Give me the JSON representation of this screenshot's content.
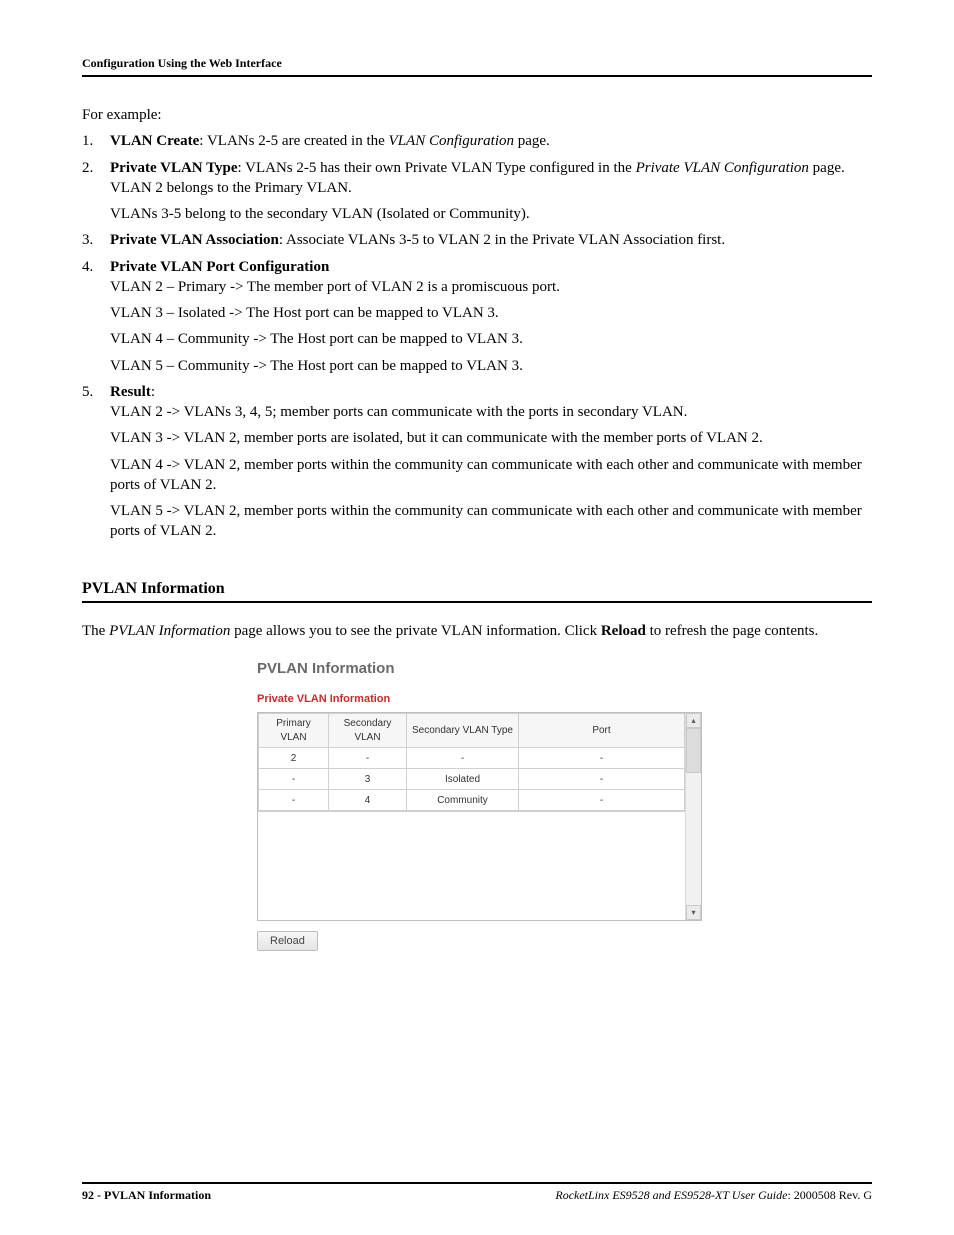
{
  "header": {
    "running": "Configuration Using the Web Interface"
  },
  "intro": "For example:",
  "steps": [
    {
      "label_bold": "VLAN Create",
      "label_rest": ": VLANs 2-5 are created in the ",
      "label_ital": "VLAN Configuration",
      "label_tail": " page.",
      "subs": []
    },
    {
      "label_bold": "Private VLAN Type",
      "label_rest": ": VLANs 2-5 has their own Private VLAN Type configured in the ",
      "label_ital": "Private VLAN Configuration",
      "label_tail": " page.",
      "subs": [
        "VLAN 2 belongs to the Primary VLAN.",
        "VLANs 3-5 belong to the secondary VLAN (Isolated or Community)."
      ]
    },
    {
      "label_bold": "Private VLAN Association",
      "label_rest": ": Associate VLANs 3-5 to VLAN 2 in the Private VLAN Association first.",
      "label_ital": "",
      "label_tail": "",
      "subs": []
    },
    {
      "label_bold": "Private VLAN Port Configuration",
      "label_rest": "",
      "label_ital": "",
      "label_tail": "",
      "subs": [
        "VLAN 2 – Primary -> The member port of VLAN 2 is a promiscuous port.",
        "VLAN 3 – Isolated -> The Host port can be mapped to VLAN 3.",
        "VLAN 4 – Community -> The Host port can be mapped to VLAN 3.",
        "VLAN 5 – Community -> The Host port can be mapped to VLAN 3."
      ]
    },
    {
      "label_bold": "Result",
      "label_rest": ":",
      "label_ital": "",
      "label_tail": "",
      "subs": [
        "VLAN 2 -> VLANs 3, 4, 5; member ports can communicate with the ports in secondary VLAN.",
        "VLAN 3 -> VLAN 2, member ports are isolated, but it can communicate with the member ports of VLAN 2.",
        "VLAN 4 -> VLAN 2, member ports within the community can communicate with each other and communicate with member ports of VLAN 2.",
        "VLAN 5 -> VLAN 2, member ports within the community can communicate with each other and communicate with member ports of VLAN 2."
      ]
    }
  ],
  "section": {
    "title": "PVLAN Information",
    "body_pre": "The ",
    "body_ital": "PVLAN Information",
    "body_mid": " page allows you to see the private VLAN information. Click ",
    "body_bold": "Reload",
    "body_post": " to refresh the page contents."
  },
  "ui": {
    "title": "PVLAN Information",
    "subtitle": "Private VLAN Information",
    "columns": [
      "Primary VLAN",
      "Secondary VLAN",
      "Secondary VLAN Type",
      "Port"
    ],
    "rows": [
      {
        "primary": "2",
        "secondary": "-",
        "type": "-",
        "port": "-"
      },
      {
        "primary": "-",
        "secondary": "3",
        "type": "Isolated",
        "port": "-"
      },
      {
        "primary": "-",
        "secondary": "4",
        "type": "Community",
        "port": "-"
      }
    ],
    "reload": "Reload",
    "scroll_up": "▴",
    "scroll_down": "▾"
  },
  "footer": {
    "page_no": "92",
    "page_title": "PVLAN Information",
    "guide_ital": "RocketLinx ES9528 and ES9528-XT User Guide",
    "guide_rest": ": 2000508 Rev. G"
  }
}
